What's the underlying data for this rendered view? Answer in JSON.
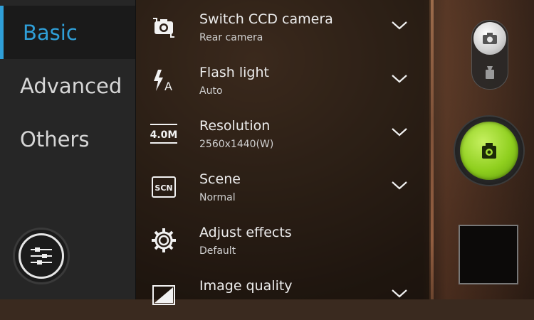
{
  "sidebar": {
    "items": [
      {
        "label": "Basic",
        "active": true
      },
      {
        "label": "Advanced",
        "active": false
      },
      {
        "label": "Others",
        "active": false
      }
    ],
    "settings_button_icon": "sliders-icon"
  },
  "settings": [
    {
      "title": "Switch CCD camera",
      "value": "Rear camera",
      "icon": "switch-camera-icon"
    },
    {
      "title": "Flash light",
      "value": "Auto",
      "icon": "flash-auto-icon"
    },
    {
      "title": "Resolution",
      "value": "2560x1440(W)",
      "icon": "resolution-icon",
      "icon_text": "4.0M"
    },
    {
      "title": "Scene",
      "value": "Normal",
      "icon": "scene-icon",
      "icon_text": "SCN"
    },
    {
      "title": "Adjust effects",
      "value": "Default",
      "icon": "gear-icon"
    },
    {
      "title": "Image quality",
      "value": "",
      "icon": "image-quality-icon"
    }
  ],
  "controls": {
    "mode_photo_icon": "camera-icon",
    "mode_video_icon": "video-camera-icon",
    "shutter_icon": "camera-icon",
    "thumbnail": "last-photo-thumbnail"
  },
  "colors": {
    "accent": "#2f9fd8",
    "shutter": "#8fcf1e"
  }
}
